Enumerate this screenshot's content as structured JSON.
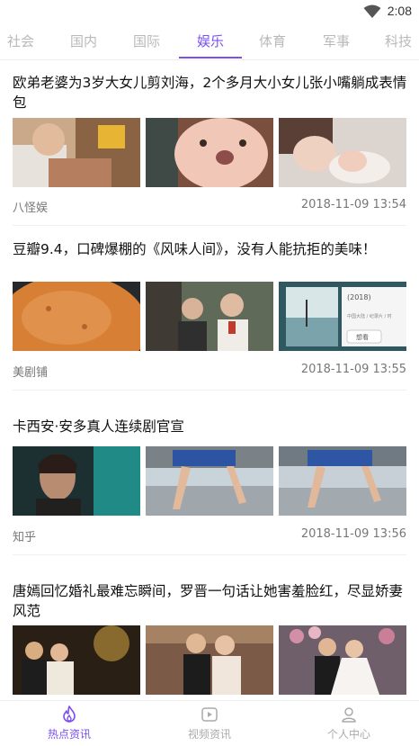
{
  "status_bar": {
    "time": "2:08"
  },
  "tabs": [
    {
      "label": "社会"
    },
    {
      "label": "国内"
    },
    {
      "label": "国际"
    },
    {
      "label": "娱乐"
    },
    {
      "label": "体育"
    },
    {
      "label": "军事"
    },
    {
      "label": "科技"
    }
  ],
  "active_tab": "娱乐",
  "articles": [
    {
      "title": "欧弟老婆为3岁大女儿剪刘海，2个多月大小女儿张小嘴躺成表情包",
      "source": "八怪娱",
      "time": "2018-11-09 13:54"
    },
    {
      "title": "豆瓣9.4，口碑爆棚的《风味人间》，没有人能抗拒的美味！",
      "source": "美剧铺",
      "time": "2018-11-09 13:55",
      "thumb_text": {
        "year": "(2018)",
        "country": "中国大陆 / 纪录片 / 时",
        "button": "想看"
      }
    },
    {
      "title": "卡西安·安多真人连续剧官宣",
      "source": "知乎",
      "time": "2018-11-09 13:56"
    },
    {
      "title": "唐嫣回忆婚礼最难忘瞬间，罗晋一句话让她害羞脸红，尽显娇妻风范",
      "source": "",
      "time": ""
    }
  ],
  "bottom_nav": [
    {
      "label": "热点资讯",
      "icon": "flame-icon",
      "active": true
    },
    {
      "label": "视频资讯",
      "icon": "video-icon",
      "active": false
    },
    {
      "label": "个人中心",
      "icon": "person-icon",
      "active": false
    }
  ],
  "colors": {
    "accent": "#7b4ff0",
    "inactive": "#aaaaaa"
  }
}
